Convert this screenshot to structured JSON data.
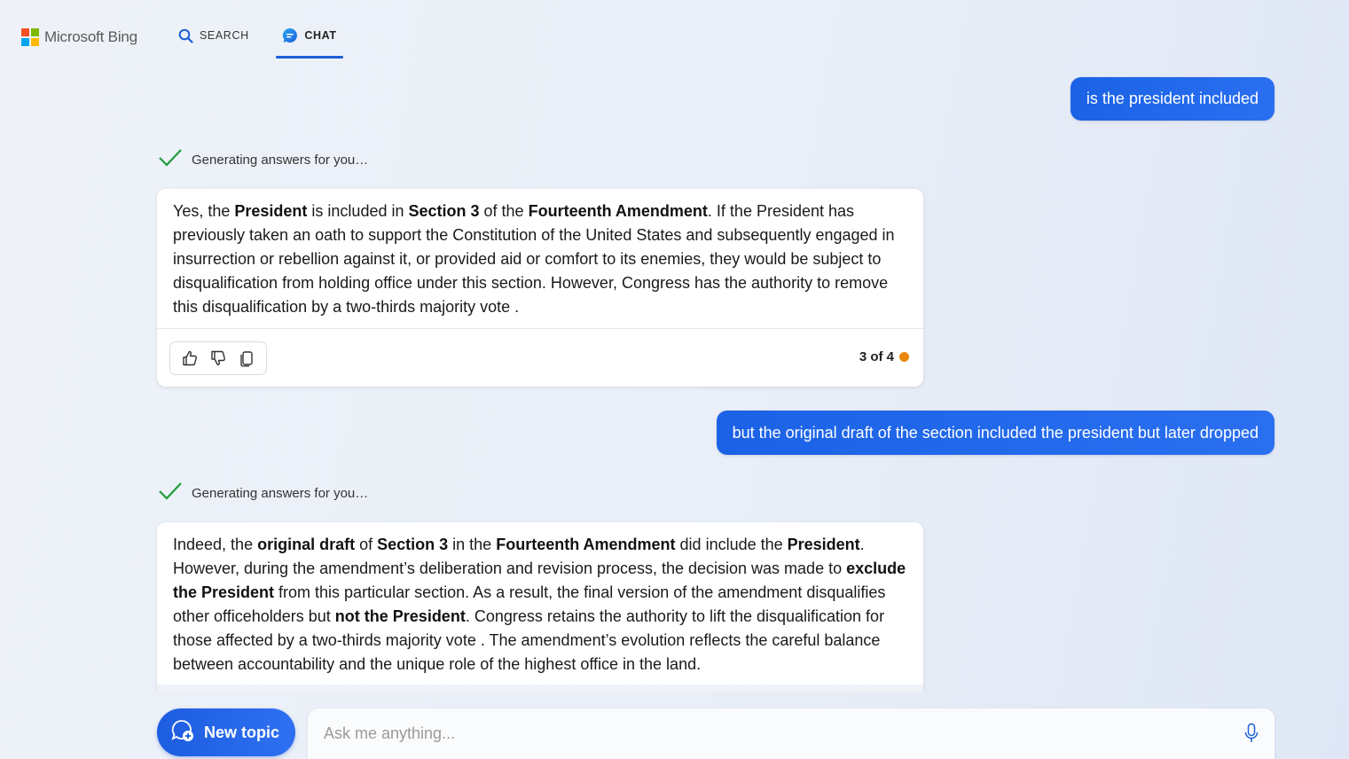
{
  "header": {
    "logo_text": "Microsoft Bing",
    "tabs": [
      {
        "label": "SEARCH",
        "icon": "search-icon",
        "active": false
      },
      {
        "label": "CHAT",
        "icon": "chat-icon",
        "active": true
      }
    ]
  },
  "conversation": {
    "user_messages": [
      "is the president  included",
      "but the original draft of the section included the president but later dropped"
    ],
    "status_text": "Generating answers for you…",
    "answers": [
      {
        "segments": [
          {
            "text": "Yes, the ",
            "bold": false
          },
          {
            "text": "President",
            "bold": true
          },
          {
            "text": " is included in ",
            "bold": false
          },
          {
            "text": "Section 3",
            "bold": true
          },
          {
            "text": " of the ",
            "bold": false
          },
          {
            "text": "Fourteenth Amendment",
            "bold": true
          },
          {
            "text": ". If the President has previously taken an oath to support the Constitution of the United States and subsequently engaged in insurrection or rebellion against it, or provided aid or comfort to its enemies, they would be subject to disqualification from holding office under this section. However, Congress has the authority to remove this disqualification by a two-thirds majority vote .",
            "bold": false
          }
        ],
        "counter": "3 of 4"
      },
      {
        "segments": [
          {
            "text": "Indeed, the ",
            "bold": false
          },
          {
            "text": "original draft",
            "bold": true
          },
          {
            "text": " of ",
            "bold": false
          },
          {
            "text": "Section 3",
            "bold": true
          },
          {
            "text": " in the ",
            "bold": false
          },
          {
            "text": "Fourteenth Amendment",
            "bold": true
          },
          {
            "text": " did include the ",
            "bold": false
          },
          {
            "text": "President",
            "bold": true
          },
          {
            "text": ". However, during the amendment’s deliberation and revision process, the decision was made to ",
            "bold": false
          },
          {
            "text": "exclude the President",
            "bold": true
          },
          {
            "text": " from this particular section. As a result, the final version of the amendment disqualifies other officeholders but ",
            "bold": false
          },
          {
            "text": "not the President",
            "bold": true
          },
          {
            "text": ". Congress retains the authority to lift the disqualification for those affected by a two-thirds majority vote . The amendment’s evolution reflects the careful balance between accountability and the unique role of the highest office in the land.",
            "bold": false
          }
        ]
      }
    ]
  },
  "composer": {
    "new_topic_label": "New topic",
    "placeholder": "Ask me anything..."
  },
  "colors": {
    "accent": "#1b5fd9",
    "counter_dot": "#e8870b",
    "check": "#1f9e3a"
  }
}
